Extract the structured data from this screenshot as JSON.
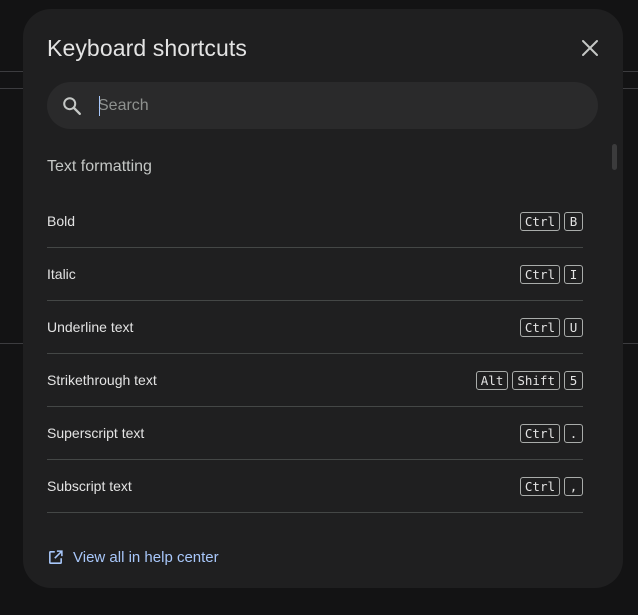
{
  "dialog": {
    "title": "Keyboard shortcuts",
    "close_icon": "close-icon"
  },
  "search": {
    "placeholder": "Search",
    "value": "",
    "icon": "search-icon"
  },
  "section": {
    "title": "Text formatting"
  },
  "shortcuts": [
    {
      "label": "Bold",
      "keys": [
        "Ctrl",
        "B"
      ]
    },
    {
      "label": "Italic",
      "keys": [
        "Ctrl",
        "I"
      ]
    },
    {
      "label": "Underline text",
      "keys": [
        "Ctrl",
        "U"
      ]
    },
    {
      "label": "Strikethrough text",
      "keys": [
        "Alt",
        "Shift",
        "5"
      ]
    },
    {
      "label": "Superscript text",
      "keys": [
        "Ctrl",
        "."
      ]
    },
    {
      "label": "Subscript text",
      "keys": [
        "Ctrl",
        ","
      ]
    }
  ],
  "footer": {
    "help_link": "View all in help center",
    "help_icon": "open-in-new-icon"
  },
  "colors": {
    "dialog_bg": "#1f1f20",
    "link": "#a8c7fa",
    "text": "#e3e3e3"
  }
}
